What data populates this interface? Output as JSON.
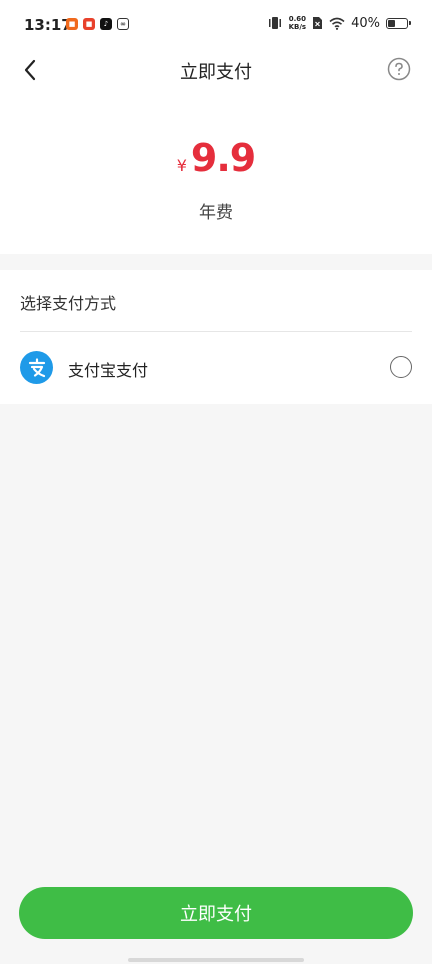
{
  "status_bar": {
    "time": "13:17",
    "net_speed_value": "0.60",
    "net_speed_unit": "KB/s",
    "battery_percent": "40%",
    "battery_level": 0.4
  },
  "header": {
    "title": "立即支付"
  },
  "price": {
    "currency": "¥",
    "amount": "9.9",
    "caption": "年费"
  },
  "payment": {
    "section_title": "选择支付方式",
    "methods": [
      {
        "label": "支付宝支付",
        "icon": "alipay-icon",
        "selected": false
      }
    ]
  },
  "footer": {
    "pay_button_label": "立即支付"
  },
  "colors": {
    "price_red": "#e52e3c",
    "pay_green": "#3fbd46",
    "alipay_blue": "#1f9ae8"
  }
}
